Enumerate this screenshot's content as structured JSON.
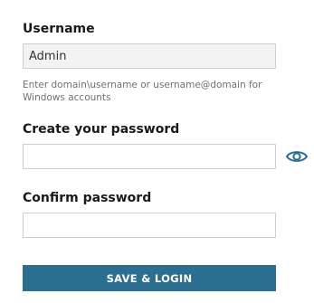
{
  "username": {
    "label": "Username",
    "value": "Admin",
    "hint": "Enter domain\\username or username@domain for Windows accounts"
  },
  "create_password": {
    "label": "Create your password",
    "value": "",
    "reveal_icon": "eye-icon"
  },
  "confirm_password": {
    "label": "Confirm password",
    "value": ""
  },
  "submit": {
    "label": "SAVE & LOGIN"
  },
  "colors": {
    "button_bg": "#2b6e8f",
    "eye_icon": "#2b6e8f"
  }
}
